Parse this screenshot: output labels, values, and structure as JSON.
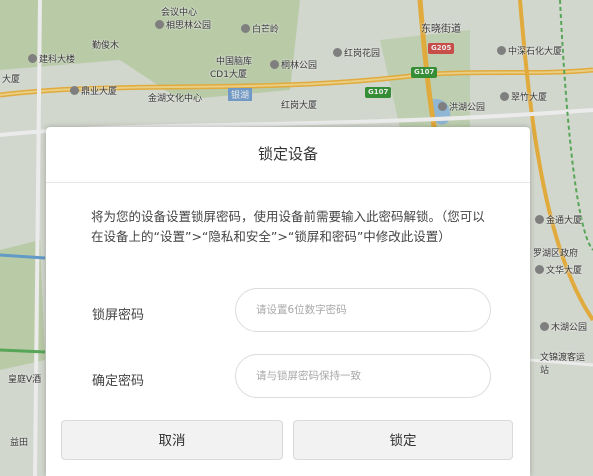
{
  "map": {
    "labels": [
      {
        "text": "相思林公园",
        "poi": true
      },
      {
        "text": "白芒岭",
        "poi": true
      },
      {
        "text": "东晓街道",
        "poi": false
      },
      {
        "text": "会议中心",
        "poi": false
      },
      {
        "text": "勤俊木",
        "poi": false
      },
      {
        "text": "建科大楼",
        "poi": true
      },
      {
        "text": "中国脑库",
        "poi": false
      },
      {
        "text": "CD1大厦",
        "poi": false
      },
      {
        "text": "桐林公园",
        "poi": true
      },
      {
        "text": "红岗花园",
        "poi": true
      },
      {
        "text": "中深石化大厦",
        "poi": true
      },
      {
        "text": "大厦",
        "poi": false
      },
      {
        "text": "鼎业大厦",
        "poi": true
      },
      {
        "text": "金湖文化中心",
        "poi": false
      },
      {
        "text": "银湖",
        "poi": false
      },
      {
        "text": "红岗大厦",
        "poi": false
      },
      {
        "text": "洪湖公园",
        "poi": true
      },
      {
        "text": "翠竹大厦",
        "poi": true
      },
      {
        "text": "金通大厦",
        "poi": true
      },
      {
        "text": "罗湖区政府",
        "poi": false
      },
      {
        "text": "文华大厦",
        "poi": true
      },
      {
        "text": "木湖公园",
        "poi": true
      },
      {
        "text": "文锦渡客运站",
        "poi": false
      },
      {
        "text": "皇庭V酒",
        "poi": false
      },
      {
        "text": "益田",
        "poi": false
      }
    ],
    "roads": {
      "g205": "G205",
      "g107a": "G107",
      "g107b": "G107"
    },
    "road_color": "#3a9a3a",
    "highway_color": "#f5b942"
  },
  "dialog": {
    "title": "锁定设备",
    "description": "将为您的设备设置锁屏密码，使用设备前需要输入此密码解锁。（您可以在设备上的“设置”>“隐私和安全”>“锁屏和密码”中修改此设置）",
    "password_label": "锁屏密码",
    "password_placeholder": "请设置6位数字密码",
    "confirm_label": "确定密码",
    "confirm_placeholder": "请与锁屏密码保持一致",
    "cancel_label": "取消",
    "lock_label": "锁定"
  }
}
